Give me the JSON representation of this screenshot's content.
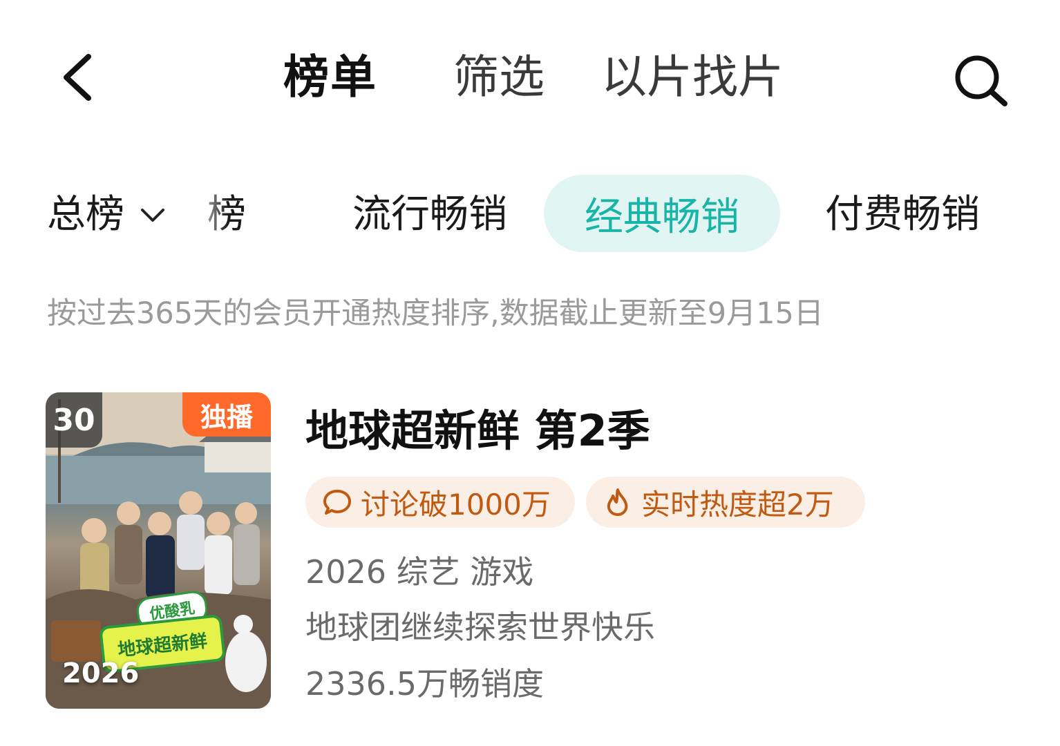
{
  "header": {
    "tabs": [
      {
        "label": "榜单",
        "active": true
      },
      {
        "label": "筛选",
        "active": false
      },
      {
        "label": "以片找片",
        "active": false
      }
    ]
  },
  "categories": {
    "dropdown_label": "总榜",
    "items": [
      "十榜",
      "流行畅销",
      "经典畅销",
      "付费畅销"
    ],
    "selected": "经典畅销"
  },
  "description": "按过去365天的会员开通热度排序,数据截止更新至9月15日",
  "items": [
    {
      "rank": "30",
      "badge": "独播",
      "poster_year": "2026",
      "poster_logo_top": "优酸乳",
      "poster_logo": "地球超新鲜",
      "title": "地球超新鲜 第2季",
      "tags": [
        {
          "icon": "comment-icon",
          "text": "讨论破1000万"
        },
        {
          "icon": "flame-icon",
          "text": "实时热度超2万"
        }
      ],
      "meta": "2026 综艺 游戏",
      "summary": "地球团继续探索世界快乐",
      "sales": "2336.5万畅销度"
    }
  ],
  "colors": {
    "accent": "#19b4a8",
    "accent_bg": "#e1f6f3",
    "tag_text": "#c05a12",
    "tag_bg": "#fbeee4",
    "exclusive_badge": "#ff6a2b"
  }
}
